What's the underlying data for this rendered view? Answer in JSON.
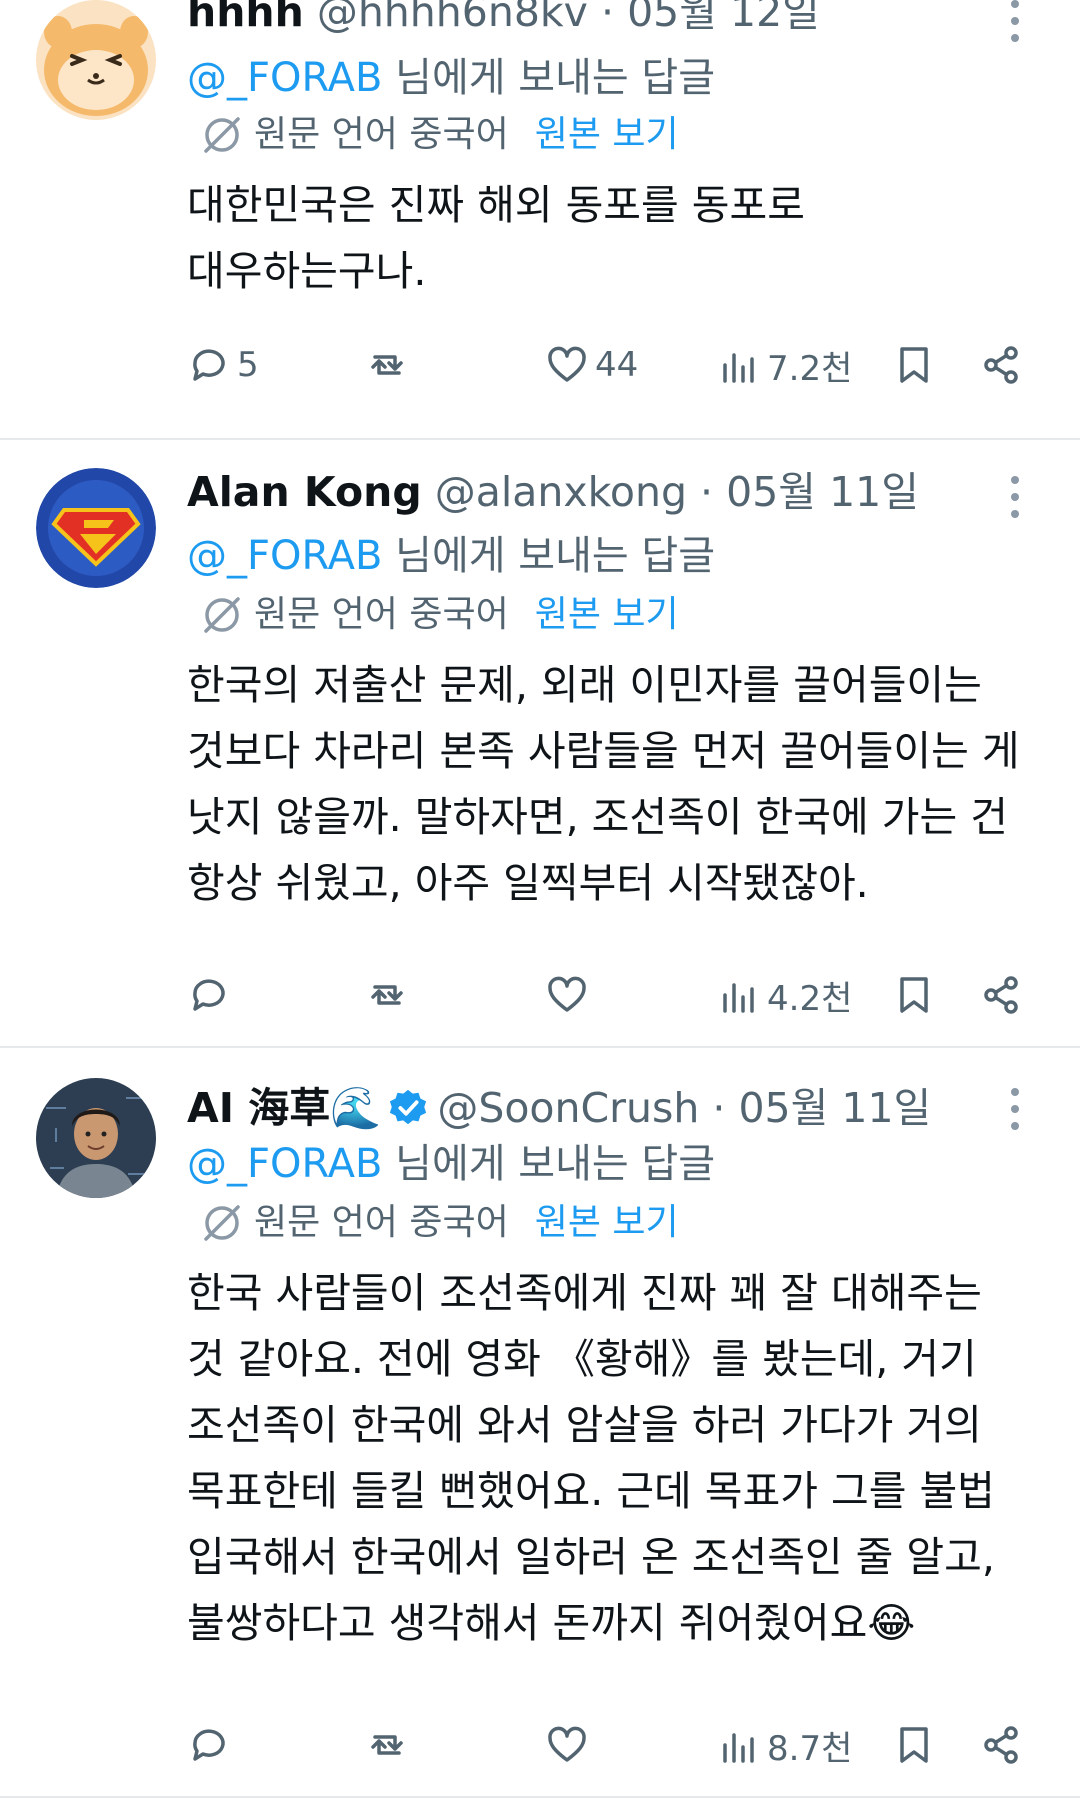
{
  "tweets": [
    {
      "display_name": "hhhh",
      "handle": "@hhhh6n8kv",
      "separator": "·",
      "date": "05월 12일",
      "reply_mention": "@_FORAB",
      "reply_suffix": " 님에게 보내는 답글",
      "translated_from": "원문 언어 중국어",
      "show_original": "원본 보기",
      "body": [
        "대한민국은 진짜 해외 동포를 동포로",
        "대우하는구나."
      ],
      "replies": "5",
      "retweets": "",
      "likes": "44",
      "views": "7.2천"
    },
    {
      "display_name": "Alan Kong",
      "handle": "@alanxkong",
      "separator": "·",
      "date": "05월 11일",
      "reply_mention": "@_FORAB",
      "reply_suffix": " 님에게 보내는 답글",
      "translated_from": "원문 언어 중국어",
      "show_original": "원본 보기",
      "body": [
        "한국의 저출산 문제, 외래 이민자를 끌어들이는",
        "것보다 차라리 본족 사람들을 먼저 끌어들이는 게",
        "낫지 않을까. 말하자면, 조선족이 한국에 가는 건",
        "항상 쉬웠고, 아주 일찍부터 시작됐잖아."
      ],
      "replies": "",
      "retweets": "",
      "likes": "",
      "views": "4.2천"
    },
    {
      "display_name": "AI 海草🌊",
      "handle": "@SoonCrush",
      "separator": "·",
      "date": "05월 11일",
      "reply_mention": "@_FORAB",
      "reply_suffix": " 님에게 보내는 답글",
      "translated_from": "원문 언어 중국어",
      "show_original": "원본 보기",
      "body": [
        "한국 사람들이 조선족에게 진짜 꽤 잘 대해주는",
        "것 같아요. 전에 영화 《황해》를 봤는데, 거기",
        "조선족이 한국에 와서 암살을 하러 가다가 거의",
        "목표한테 들킬 뻔했어요. 근데 목표가 그를 불법",
        "입국해서 한국에서 일하러 온 조선족인 줄 알고,",
        "불쌍하다고 생각해서 돈까지 쥐어줬어요😂"
      ],
      "replies": "",
      "retweets": "",
      "likes": "",
      "views": "8.7천",
      "verified": true
    }
  ],
  "colors": {
    "link": "#1d9bf0",
    "secondary": "#536471",
    "text": "#0f1419",
    "verified": "#1d9bf0"
  },
  "icons": {
    "reply": "speech-bubble-icon",
    "retweet": "retweet-icon",
    "like": "heart-icon",
    "views": "bar-chart-icon",
    "bookmark": "bookmark-icon",
    "share": "share-icon",
    "translate": "translate-icon",
    "more": "more-dots-icon",
    "verified": "verified-badge-icon"
  }
}
